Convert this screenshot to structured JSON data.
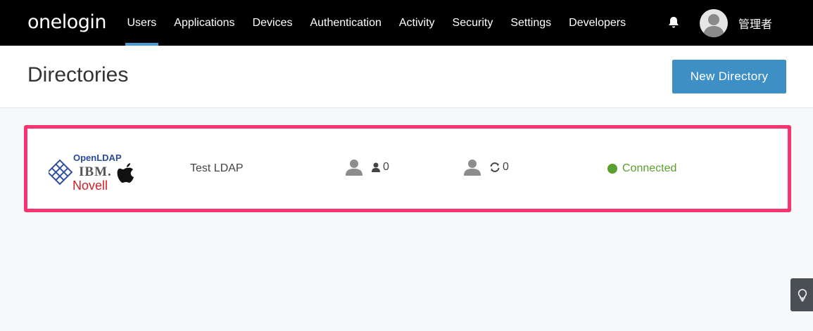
{
  "brand": {
    "logo_text": "onelogin"
  },
  "nav": {
    "items": [
      {
        "label": "Users",
        "active": true
      },
      {
        "label": "Applications"
      },
      {
        "label": "Devices"
      },
      {
        "label": "Authentication"
      },
      {
        "label": "Activity"
      },
      {
        "label": "Security"
      },
      {
        "label": "Settings"
      },
      {
        "label": "Developers"
      }
    ],
    "bell_icon": "bell-icon",
    "user_name": "管理者"
  },
  "header": {
    "title": "Directories",
    "new_button": "New Directory"
  },
  "directory": {
    "logo_texts": [
      "OpenLDAP",
      "IBM.",
      "Novell"
    ],
    "name": "Test LDAP",
    "users_count": "0",
    "synced_count": "0",
    "status": "Connected"
  },
  "colors": {
    "nav_bg": "#000000",
    "accent": "#4a9ad6",
    "button": "#3e8fc6",
    "highlight_border": "#f7346f",
    "connected": "#5aa02c"
  },
  "help": {
    "icon": "lightbulb-icon"
  }
}
